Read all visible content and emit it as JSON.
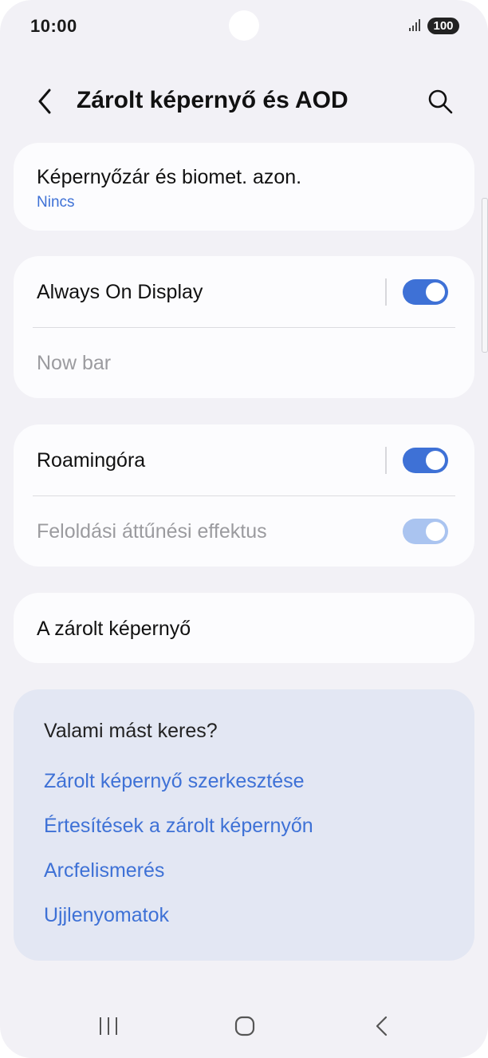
{
  "status_bar": {
    "time": "10:00",
    "battery": "100",
    "icons": [
      "signal-icon",
      "battery-icon"
    ]
  },
  "header": {
    "title": "Zárolt képernyő és AOD",
    "icons": [
      "back-icon",
      "search-icon"
    ]
  },
  "card_screen_lock": {
    "label": "Képernyőzár és biomet. azon.",
    "value": "Nincs"
  },
  "card_aod": {
    "always_on_display": {
      "label": "Always On Display",
      "enabled": true
    },
    "now_bar": {
      "label": "Now bar",
      "disabled": true
    }
  },
  "card_roaming": {
    "roaming_clock": {
      "label": "Roamingóra",
      "enabled": true
    },
    "unlock_transition": {
      "label": "Feloldási áttűnési effektus",
      "enabled": true,
      "disabled": true
    }
  },
  "card_lockscreen": {
    "label": "A zárolt képernyő"
  },
  "suggestions": {
    "title": "Valami mást keres?",
    "links": [
      "Zárolt képernyő szerkesztése",
      "Értesítések a zárolt képernyőn",
      "Arcfelismerés",
      "Ujjlenyomatok"
    ]
  },
  "nav_bar": {
    "icons": [
      "recents-icon",
      "home-icon",
      "back-nav-icon"
    ]
  },
  "colors": {
    "accent": "#3e71d6",
    "accent_disabled": "#aac4f0",
    "background": "#f2f1f6",
    "card": "#fcfcfe",
    "suggestion_panel": "#e3e7f3"
  }
}
